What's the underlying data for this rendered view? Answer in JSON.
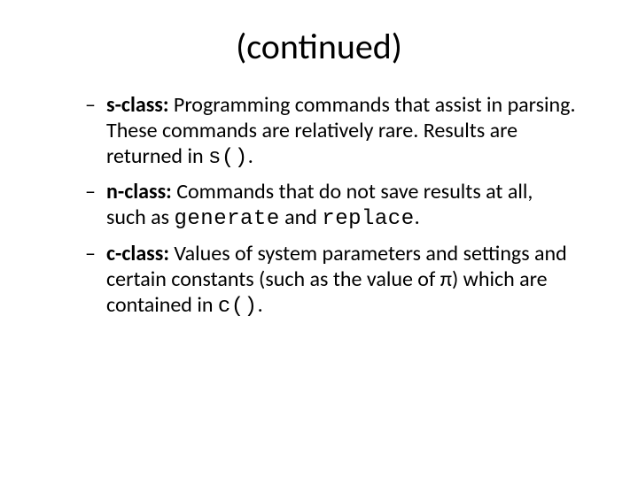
{
  "title": "(continued)",
  "bullets": [
    {
      "label": "s-class:",
      "pre": "Programming commands that assist in parsing. These commands are relatively rare. Results are returned in ",
      "code_a": "s()",
      "mid": "",
      "code_b": "",
      "post": "."
    },
    {
      "label": "n-class:",
      "pre": "Commands that do not save results at all, such as ",
      "code_a": "generate",
      "mid": " and ",
      "code_b": "replace",
      "post": "."
    },
    {
      "label": "c-class:",
      "pre": "Values of system parameters and settings and certain constants (such as the value of π) which are contained in ",
      "code_a": "c()",
      "mid": "",
      "code_b": "",
      "post": "."
    }
  ]
}
